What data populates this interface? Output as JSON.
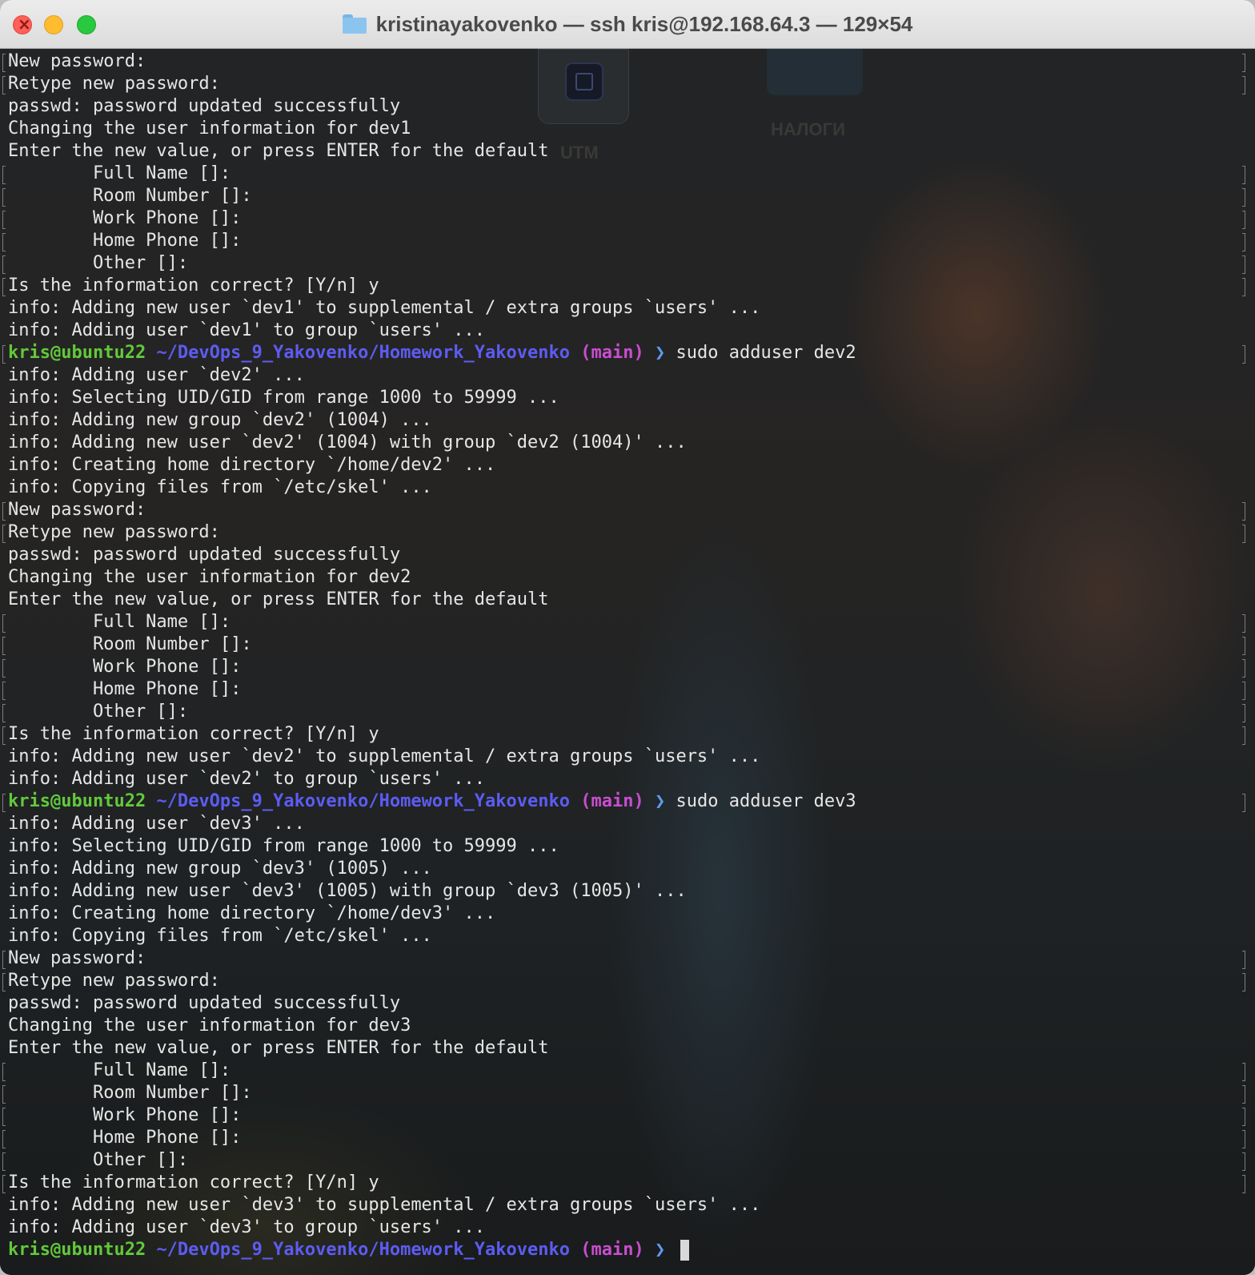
{
  "window": {
    "title": "kristinayakovenko — ssh kris@192.168.64.3 — 129×54",
    "folder_icon": "folder-icon"
  },
  "desktop": {
    "icons": [
      {
        "name": "utm-app-icon",
        "label": "UTM"
      },
      {
        "name": "folder-nalogi-icon",
        "label": "НАЛОГИ"
      }
    ]
  },
  "prompt": {
    "user_host": "kris@ubuntu22",
    "path": "~/DevOps_9_Yakovenko/Homework_Yakovenko",
    "branch": "(main)",
    "arrow": "❯"
  },
  "colors": {
    "user": "#62c93a",
    "path": "#5c5cf2",
    "branch": "#c94ed0",
    "arrow": "#5c9cf2",
    "text": "#e6e6e6"
  },
  "terminal_lines": [
    {
      "text": "New password:",
      "br": true
    },
    {
      "text": "Retype new password:",
      "br": true
    },
    {
      "text": "passwd: password updated successfully",
      "br": false
    },
    {
      "text": "Changing the user information for dev1",
      "br": false
    },
    {
      "text": "Enter the new value, or press ENTER for the default",
      "br": false
    },
    {
      "text": "        Full Name []:",
      "br": true
    },
    {
      "text": "        Room Number []:",
      "br": true
    },
    {
      "text": "        Work Phone []:",
      "br": true
    },
    {
      "text": "        Home Phone []:",
      "br": true
    },
    {
      "text": "        Other []:",
      "br": true
    },
    {
      "text": "Is the information correct? [Y/n] y",
      "br": true
    },
    {
      "text": "info: Adding new user `dev1' to supplemental / extra groups `users' ...",
      "br": false
    },
    {
      "text": "info: Adding user `dev1' to group `users' ...",
      "br": false
    },
    {
      "prompt": true,
      "cmd": "sudo adduser dev2",
      "br": true
    },
    {
      "text": "info: Adding user `dev2' ...",
      "br": false
    },
    {
      "text": "info: Selecting UID/GID from range 1000 to 59999 ...",
      "br": false
    },
    {
      "text": "info: Adding new group `dev2' (1004) ...",
      "br": false
    },
    {
      "text": "info: Adding new user `dev2' (1004) with group `dev2 (1004)' ...",
      "br": false
    },
    {
      "text": "info: Creating home directory `/home/dev2' ...",
      "br": false
    },
    {
      "text": "info: Copying files from `/etc/skel' ...",
      "br": false
    },
    {
      "text": "New password:",
      "br": true
    },
    {
      "text": "Retype new password:",
      "br": true
    },
    {
      "text": "passwd: password updated successfully",
      "br": false
    },
    {
      "text": "Changing the user information for dev2",
      "br": false
    },
    {
      "text": "Enter the new value, or press ENTER for the default",
      "br": false
    },
    {
      "text": "        Full Name []:",
      "br": true
    },
    {
      "text": "        Room Number []:",
      "br": true
    },
    {
      "text": "        Work Phone []:",
      "br": true
    },
    {
      "text": "        Home Phone []:",
      "br": true
    },
    {
      "text": "        Other []:",
      "br": true
    },
    {
      "text": "Is the information correct? [Y/n] y",
      "br": true
    },
    {
      "text": "info: Adding new user `dev2' to supplemental / extra groups `users' ...",
      "br": false
    },
    {
      "text": "info: Adding user `dev2' to group `users' ...",
      "br": false
    },
    {
      "prompt": true,
      "cmd": "sudo adduser dev3",
      "br": true
    },
    {
      "text": "info: Adding user `dev3' ...",
      "br": false
    },
    {
      "text": "info: Selecting UID/GID from range 1000 to 59999 ...",
      "br": false
    },
    {
      "text": "info: Adding new group `dev3' (1005) ...",
      "br": false
    },
    {
      "text": "info: Adding new user `dev3' (1005) with group `dev3 (1005)' ...",
      "br": false
    },
    {
      "text": "info: Creating home directory `/home/dev3' ...",
      "br": false
    },
    {
      "text": "info: Copying files from `/etc/skel' ...",
      "br": false
    },
    {
      "text": "New password:",
      "br": true
    },
    {
      "text": "Retype new password:",
      "br": true
    },
    {
      "text": "passwd: password updated successfully",
      "br": false
    },
    {
      "text": "Changing the user information for dev3",
      "br": false
    },
    {
      "text": "Enter the new value, or press ENTER for the default",
      "br": false
    },
    {
      "text": "        Full Name []:",
      "br": true
    },
    {
      "text": "        Room Number []:",
      "br": true
    },
    {
      "text": "        Work Phone []:",
      "br": true
    },
    {
      "text": "        Home Phone []:",
      "br": true
    },
    {
      "text": "        Other []:",
      "br": true
    },
    {
      "text": "Is the information correct? [Y/n] y",
      "br": true
    },
    {
      "text": "info: Adding new user `dev3' to supplemental / extra groups `users' ...",
      "br": false
    },
    {
      "text": "info: Adding user `dev3' to group `users' ...",
      "br": false
    },
    {
      "prompt": true,
      "cmd": "",
      "cursor": true,
      "br": false
    }
  ]
}
